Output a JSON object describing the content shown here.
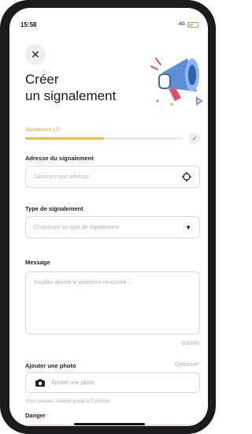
{
  "status_bar": {
    "time": "15:58",
    "network": "4G"
  },
  "header": {
    "title_line1": "Créer",
    "title_line2": "un signalement"
  },
  "progress": {
    "label": "Signalement 1/2",
    "value": 0.5
  },
  "address": {
    "label": "Adresse du signalement",
    "placeholder": "Saisissez une adresse"
  },
  "type": {
    "label": "Type de signalement",
    "placeholder": "Choisissez un type de signalement"
  },
  "message": {
    "label": "Message",
    "placeholder": "Veuillez décrire le problème rencontré...",
    "counter": "0/1000"
  },
  "photo": {
    "label": "Ajouter une photo",
    "optional": "Optionnel",
    "button": "Ajouter une photo",
    "hint": "Vous pouvez insérer jusqu'à 5 photos"
  },
  "danger": {
    "label": "Danger"
  },
  "icons": [
    "close-icon",
    "megaphone-illustration",
    "check-icon",
    "location-target-icon",
    "dropdown-caret-icon",
    "camera-icon"
  ]
}
